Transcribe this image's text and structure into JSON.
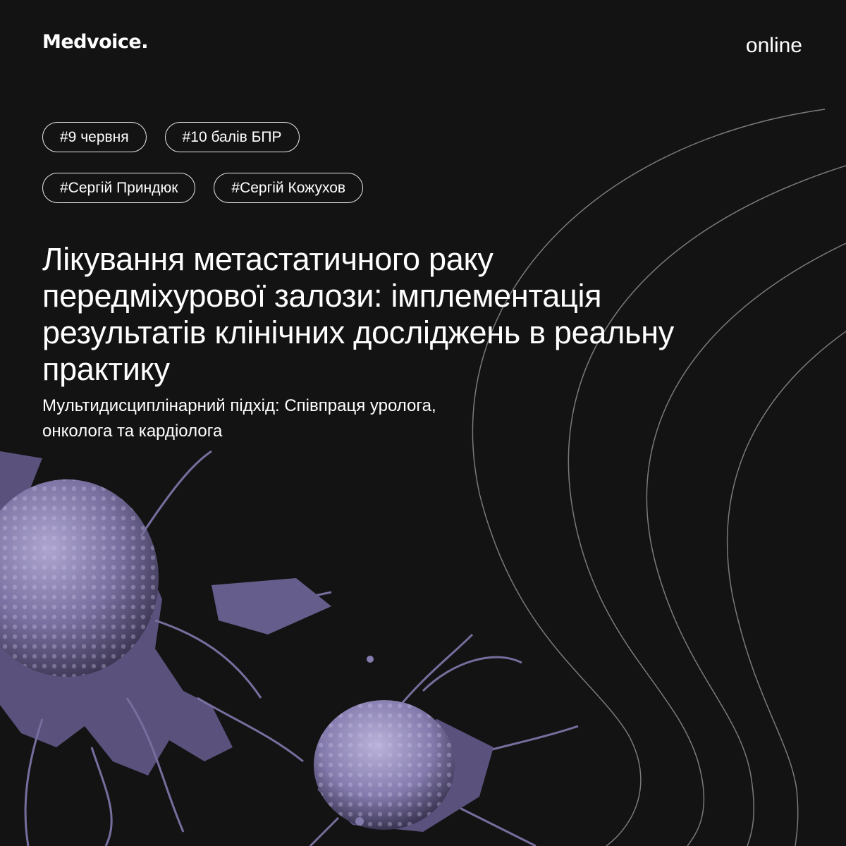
{
  "header": {
    "logo": "Medvoice.",
    "mode": "online"
  },
  "tags": [
    [
      "#9 червня",
      "#10 балів БПР"
    ],
    [
      "#Сергій Приндюк",
      "#Сергій Кожухов"
    ]
  ],
  "title": "Лікування метастатичного раку передміхурової залози: імплементація результатів клінічних досліджень в реальну практику",
  "subtitle": "Мультидисциплінарний підхід: Співпраця уролога, онколога та кардіолога",
  "colors": {
    "background": "#131313",
    "text": "#ffffff",
    "cell_tint": "#8a80b0",
    "arc_stroke": "#7a7a7a"
  }
}
